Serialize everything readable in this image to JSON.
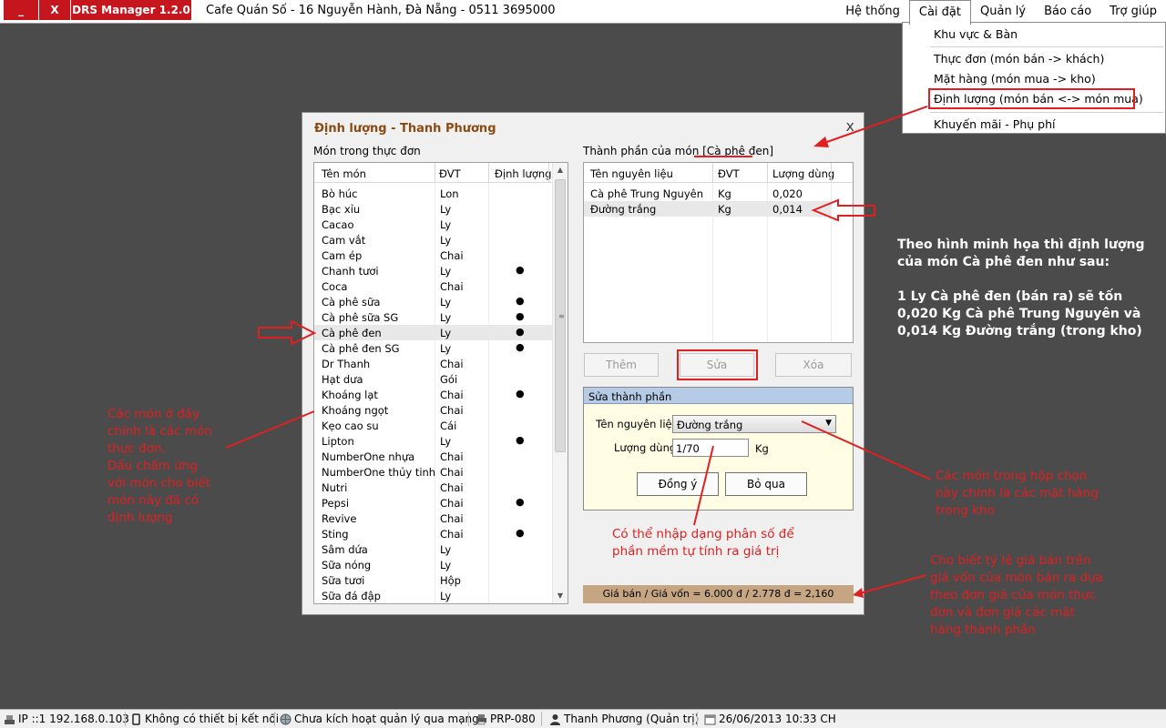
{
  "window": {
    "minimize_label": "_",
    "close_label": "X",
    "app_title": "DRS Manager 1.2.0",
    "business_info": "Cafe Quán Số  -  16 Nguyễn Hành, Đà Nẵng  -  0511 3695000"
  },
  "menu": {
    "items": [
      {
        "label": "Hệ thống"
      },
      {
        "label": "Cài đặt"
      },
      {
        "label": "Quản lý"
      },
      {
        "label": "Báo cáo"
      },
      {
        "label": "Trợ giúp"
      }
    ],
    "dropdown": [
      {
        "label": "Khu vực & Bàn"
      },
      {
        "label": "Thực đơn (món bán -> khách)"
      },
      {
        "label": "Mặt hàng (món mua -> kho)"
      },
      {
        "label": "Định lượng (món bán <-> món mua)"
      },
      {
        "label": "Khuyến mãi - Phụ phí"
      }
    ]
  },
  "dialog": {
    "title": "Định lượng - Thanh Phương",
    "close": "x",
    "menu_section_label": "Món trong thực đơn",
    "menu_columns": [
      "Tên món",
      "ĐVT",
      "Định lượng"
    ],
    "menu_rows": [
      {
        "name": "Bò húc",
        "unit": "Lon",
        "dot": ""
      },
      {
        "name": "Bạc xỉu",
        "unit": "Ly",
        "dot": ""
      },
      {
        "name": "Cacao",
        "unit": "Ly",
        "dot": ""
      },
      {
        "name": "Cam vắt",
        "unit": "Ly",
        "dot": ""
      },
      {
        "name": "Cam ép",
        "unit": "Chai",
        "dot": ""
      },
      {
        "name": "Chanh tươi",
        "unit": "Ly",
        "dot": "●"
      },
      {
        "name": "Coca",
        "unit": "Chai",
        "dot": ""
      },
      {
        "name": "Cà phê sữa",
        "unit": "Ly",
        "dot": "●"
      },
      {
        "name": "Cà phê sữa SG",
        "unit": "Ly",
        "dot": "●"
      },
      {
        "name": "Cà phê đen",
        "unit": "Ly",
        "dot": "●"
      },
      {
        "name": "Cà phê đen SG",
        "unit": "Ly",
        "dot": "●"
      },
      {
        "name": "Dr Thanh",
        "unit": "Chai",
        "dot": ""
      },
      {
        "name": "Hạt dưa",
        "unit": "Gói",
        "dot": ""
      },
      {
        "name": "Khoáng lạt",
        "unit": "Chai",
        "dot": "●"
      },
      {
        "name": "Khoáng ngọt",
        "unit": "Chai",
        "dot": ""
      },
      {
        "name": "Kẹo cao su",
        "unit": "Cái",
        "dot": ""
      },
      {
        "name": "Lipton",
        "unit": "Ly",
        "dot": "●"
      },
      {
        "name": "NumberOne nhựa",
        "unit": "Chai",
        "dot": ""
      },
      {
        "name": "NumberOne thủy tinh",
        "unit": "Chai",
        "dot": ""
      },
      {
        "name": "Nutri",
        "unit": "Chai",
        "dot": ""
      },
      {
        "name": "Pepsi",
        "unit": "Chai",
        "dot": "●"
      },
      {
        "name": "Revive",
        "unit": "Chai",
        "dot": ""
      },
      {
        "name": "Sting",
        "unit": "Chai",
        "dot": "●"
      },
      {
        "name": "Sâm dứa",
        "unit": "Ly",
        "dot": ""
      },
      {
        "name": "Sữa nóng",
        "unit": "Ly",
        "dot": ""
      },
      {
        "name": "Sữa tươi",
        "unit": "Hộp",
        "dot": ""
      },
      {
        "name": "Sữa đá đập",
        "unit": "Ly",
        "dot": ""
      }
    ],
    "ingredients_label_prefix": "Thành phần của món [",
    "ingredients_dish": "Cà phê đen",
    "ingredients_label_suffix": "]",
    "ingredient_columns": [
      "Tên nguyên liệu",
      "ĐVT",
      "Lượng dùng"
    ],
    "ingredient_rows": [
      {
        "name": "Cà phê Trung Nguyên",
        "unit": "Kg",
        "qty": "0,020"
      },
      {
        "name": "Đường trắng",
        "unit": "Kg",
        "qty": "0,014"
      }
    ],
    "buttons": {
      "add": "Thêm",
      "edit": "Sửa",
      "delete": "Xóa"
    },
    "edit_panel": {
      "title": "Sửa thành phần",
      "ingredient_label": "Tên nguyên liệu",
      "ingredient_value": "Đường trắng",
      "qty_label": "Lượng dùng",
      "qty_value": "1/70",
      "qty_unit": "Kg",
      "ok": "Đồng ý",
      "skip": "Bỏ qua"
    },
    "price_ratio": "Giá bán / Giá vốn = 6.000 đ / 2.778 đ = 2,160"
  },
  "annotations": {
    "left_note": [
      "Các món ở đây",
      "chính là các món",
      "thực đơn.",
      "Dấu chấm ứng",
      "với món cho biết",
      "món này đã có",
      "định lượng"
    ],
    "right_info": [
      "Theo hình minh họa thì định lượng",
      "của món Cà phê đen như sau:",
      "",
      "1 Ly Cà phê đen (bán ra) sẽ tốn",
      "0,020 Kg Cà phê Trung Nguyên và",
      "0,014 Kg Đường trắng (trong kho)"
    ],
    "combo_note": [
      "Các món trong hộp chọn",
      "này chính là các mặt hàng",
      "trong kho"
    ],
    "fraction_note": [
      "Có thể nhập dạng phân số để",
      "phần mềm tự tính ra giá trị"
    ],
    "ratio_note": [
      "Cho biết tỷ lệ giá bán trên",
      "giá vốn của món bán ra dựa",
      "theo đơn giá của món thực",
      "đơn và đơn giá các mặt",
      "hàng thành phần"
    ]
  },
  "statusbar": {
    "ip": "IP ::1 192.168.0.103",
    "device": "Không có thiết bị kết nối",
    "network": "Chưa kích hoạt quản lý qua mạng",
    "printer": "PRP-080",
    "user": "Thanh Phương (Quản trị)",
    "datetime": "26/06/2013 10:33 CH"
  },
  "colors": {
    "accent_red": "#c4161c",
    "annotation_red": "#e02020",
    "dialog_title": "#8b4a12",
    "panel_header": "#b6cbe6",
    "price_bar": "#c6a583"
  }
}
